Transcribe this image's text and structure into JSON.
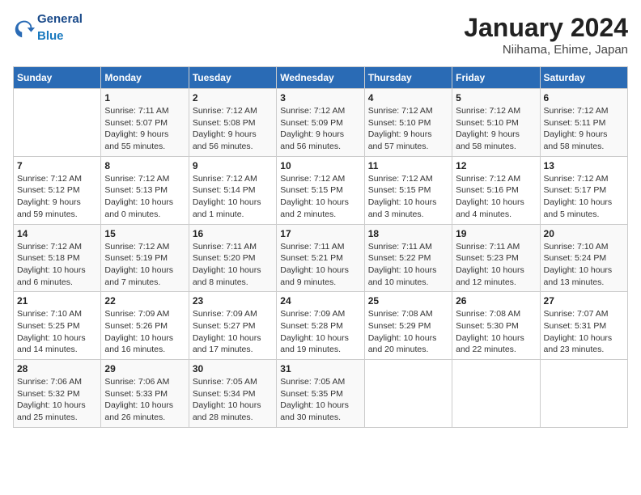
{
  "header": {
    "logo_general": "General",
    "logo_blue": "Blue",
    "title": "January 2024",
    "subtitle": "Niihama, Ehime, Japan"
  },
  "calendar": {
    "days_of_week": [
      "Sunday",
      "Monday",
      "Tuesday",
      "Wednesday",
      "Thursday",
      "Friday",
      "Saturday"
    ],
    "weeks": [
      [
        {
          "day": "",
          "info": ""
        },
        {
          "day": "1",
          "info": "Sunrise: 7:11 AM\nSunset: 5:07 PM\nDaylight: 9 hours\nand 55 minutes."
        },
        {
          "day": "2",
          "info": "Sunrise: 7:12 AM\nSunset: 5:08 PM\nDaylight: 9 hours\nand 56 minutes."
        },
        {
          "day": "3",
          "info": "Sunrise: 7:12 AM\nSunset: 5:09 PM\nDaylight: 9 hours\nand 56 minutes."
        },
        {
          "day": "4",
          "info": "Sunrise: 7:12 AM\nSunset: 5:10 PM\nDaylight: 9 hours\nand 57 minutes."
        },
        {
          "day": "5",
          "info": "Sunrise: 7:12 AM\nSunset: 5:10 PM\nDaylight: 9 hours\nand 58 minutes."
        },
        {
          "day": "6",
          "info": "Sunrise: 7:12 AM\nSunset: 5:11 PM\nDaylight: 9 hours\nand 58 minutes."
        }
      ],
      [
        {
          "day": "7",
          "info": "Sunrise: 7:12 AM\nSunset: 5:12 PM\nDaylight: 9 hours\nand 59 minutes."
        },
        {
          "day": "8",
          "info": "Sunrise: 7:12 AM\nSunset: 5:13 PM\nDaylight: 10 hours\nand 0 minutes."
        },
        {
          "day": "9",
          "info": "Sunrise: 7:12 AM\nSunset: 5:14 PM\nDaylight: 10 hours\nand 1 minute."
        },
        {
          "day": "10",
          "info": "Sunrise: 7:12 AM\nSunset: 5:15 PM\nDaylight: 10 hours\nand 2 minutes."
        },
        {
          "day": "11",
          "info": "Sunrise: 7:12 AM\nSunset: 5:15 PM\nDaylight: 10 hours\nand 3 minutes."
        },
        {
          "day": "12",
          "info": "Sunrise: 7:12 AM\nSunset: 5:16 PM\nDaylight: 10 hours\nand 4 minutes."
        },
        {
          "day": "13",
          "info": "Sunrise: 7:12 AM\nSunset: 5:17 PM\nDaylight: 10 hours\nand 5 minutes."
        }
      ],
      [
        {
          "day": "14",
          "info": "Sunrise: 7:12 AM\nSunset: 5:18 PM\nDaylight: 10 hours\nand 6 minutes."
        },
        {
          "day": "15",
          "info": "Sunrise: 7:12 AM\nSunset: 5:19 PM\nDaylight: 10 hours\nand 7 minutes."
        },
        {
          "day": "16",
          "info": "Sunrise: 7:11 AM\nSunset: 5:20 PM\nDaylight: 10 hours\nand 8 minutes."
        },
        {
          "day": "17",
          "info": "Sunrise: 7:11 AM\nSunset: 5:21 PM\nDaylight: 10 hours\nand 9 minutes."
        },
        {
          "day": "18",
          "info": "Sunrise: 7:11 AM\nSunset: 5:22 PM\nDaylight: 10 hours\nand 10 minutes."
        },
        {
          "day": "19",
          "info": "Sunrise: 7:11 AM\nSunset: 5:23 PM\nDaylight: 10 hours\nand 12 minutes."
        },
        {
          "day": "20",
          "info": "Sunrise: 7:10 AM\nSunset: 5:24 PM\nDaylight: 10 hours\nand 13 minutes."
        }
      ],
      [
        {
          "day": "21",
          "info": "Sunrise: 7:10 AM\nSunset: 5:25 PM\nDaylight: 10 hours\nand 14 minutes."
        },
        {
          "day": "22",
          "info": "Sunrise: 7:09 AM\nSunset: 5:26 PM\nDaylight: 10 hours\nand 16 minutes."
        },
        {
          "day": "23",
          "info": "Sunrise: 7:09 AM\nSunset: 5:27 PM\nDaylight: 10 hours\nand 17 minutes."
        },
        {
          "day": "24",
          "info": "Sunrise: 7:09 AM\nSunset: 5:28 PM\nDaylight: 10 hours\nand 19 minutes."
        },
        {
          "day": "25",
          "info": "Sunrise: 7:08 AM\nSunset: 5:29 PM\nDaylight: 10 hours\nand 20 minutes."
        },
        {
          "day": "26",
          "info": "Sunrise: 7:08 AM\nSunset: 5:30 PM\nDaylight: 10 hours\nand 22 minutes."
        },
        {
          "day": "27",
          "info": "Sunrise: 7:07 AM\nSunset: 5:31 PM\nDaylight: 10 hours\nand 23 minutes."
        }
      ],
      [
        {
          "day": "28",
          "info": "Sunrise: 7:06 AM\nSunset: 5:32 PM\nDaylight: 10 hours\nand 25 minutes."
        },
        {
          "day": "29",
          "info": "Sunrise: 7:06 AM\nSunset: 5:33 PM\nDaylight: 10 hours\nand 26 minutes."
        },
        {
          "day": "30",
          "info": "Sunrise: 7:05 AM\nSunset: 5:34 PM\nDaylight: 10 hours\nand 28 minutes."
        },
        {
          "day": "31",
          "info": "Sunrise: 7:05 AM\nSunset: 5:35 PM\nDaylight: 10 hours\nand 30 minutes."
        },
        {
          "day": "",
          "info": ""
        },
        {
          "day": "",
          "info": ""
        },
        {
          "day": "",
          "info": ""
        }
      ]
    ]
  }
}
